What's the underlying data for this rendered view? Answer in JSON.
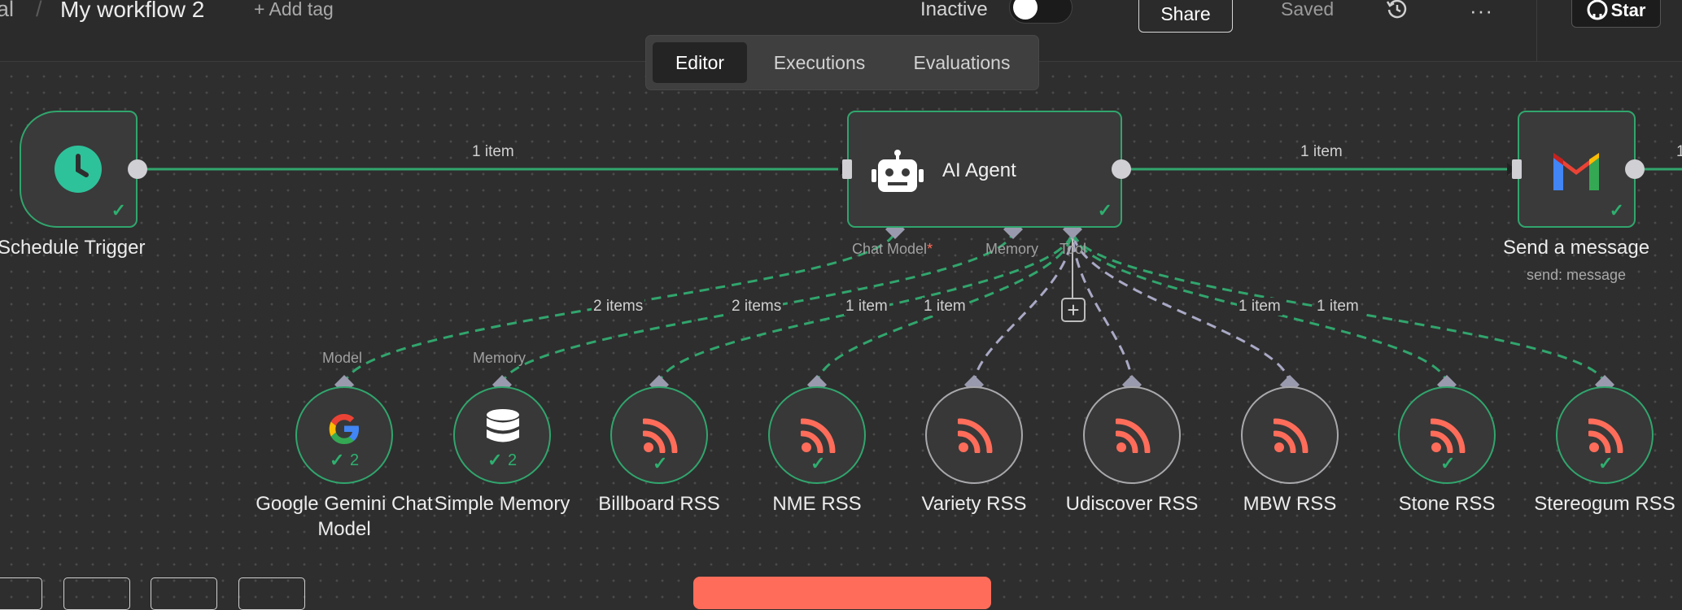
{
  "header": {
    "breadcrumb_prev": "al",
    "breadcrumb_sep": "/",
    "workflow_name": "My workflow 2",
    "add_tag": "+ Add tag",
    "status_label": "Inactive",
    "share_label": "Share",
    "saved_label": "Saved",
    "more_label": "···",
    "star_label": "Star",
    "history_icon": "history-icon",
    "github_icon": "github-icon"
  },
  "tabs": [
    {
      "label": "Editor",
      "active": true
    },
    {
      "label": "Executions",
      "active": false
    },
    {
      "label": "Evaluations",
      "active": false
    }
  ],
  "nodes": {
    "schedule_trigger": {
      "label": "Schedule Trigger",
      "icon": "clock-icon"
    },
    "ai_agent": {
      "label": "AI Agent",
      "icon": "robot-icon",
      "ports": {
        "chat_model": "Chat Model",
        "chat_model_required": "*",
        "memory": "Memory",
        "tool": "Tool"
      }
    },
    "send_message": {
      "label": "Send a message",
      "sublabel": "send: message",
      "icon": "gmail-icon"
    },
    "gemini": {
      "label_line1": "Google Gemini Chat",
      "label_line2": "Model",
      "port_label": "Model",
      "count": "2",
      "icon": "google-icon"
    },
    "memory": {
      "label": "Simple Memory",
      "port_label": "Memory",
      "count": "2",
      "icon": "database-icon"
    },
    "tools": [
      {
        "label": "Billboard RSS",
        "icon": "rss-icon",
        "status": "success"
      },
      {
        "label": "NME RSS",
        "icon": "rss-icon",
        "status": "success"
      },
      {
        "label": "Variety RSS",
        "icon": "rss-icon",
        "status": "idle"
      },
      {
        "label": "Udiscover RSS",
        "icon": "rss-icon",
        "status": "idle"
      },
      {
        "label": "MBW RSS",
        "icon": "rss-icon",
        "status": "idle"
      },
      {
        "label": "Stone RSS",
        "icon": "rss-icon",
        "status": "success"
      },
      {
        "label": "Stereogum RSS",
        "icon": "rss-icon",
        "status": "success"
      }
    ]
  },
  "edges": {
    "trigger_to_agent": "1 item",
    "agent_to_send": "1 item",
    "gemini_to_agent": "2 items",
    "memory_to_agent": "2 items",
    "billboard": "1 item",
    "nme": "1 item",
    "stone": "1 item",
    "stereogum": "1 item",
    "send_out_partial": "1"
  },
  "colors": {
    "canvas_bg": "#2e2e2e",
    "success_green": "#31a56d",
    "idle_grey": "#a9a9ad",
    "accent_orange": "#ff6d5a"
  }
}
